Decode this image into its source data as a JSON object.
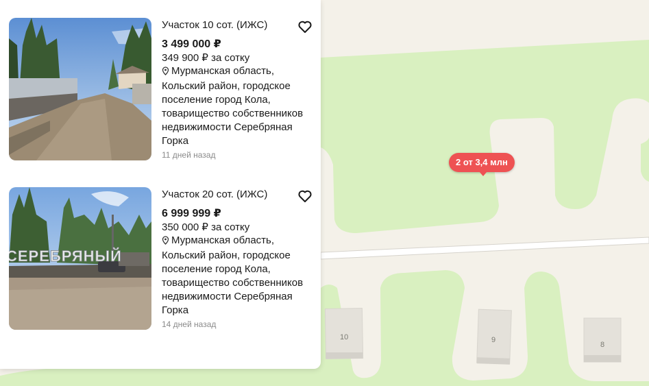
{
  "listings": [
    {
      "title": "Участок 10 сот. (ИЖС)",
      "price": "3 499 000 ₽",
      "price_per_sotka": "349 900 ₽ за сотку",
      "address": "Мурманская область, Кольский район, городское поселение город Кола, товарищество собственников недвижимости Серебряная Горка",
      "posted": "11 дней назад",
      "favorite_icon": "heart-outline-icon"
    },
    {
      "title": "Участок 20 сот. (ИЖС)",
      "price": "6 999 999 ₽",
      "price_per_sotka": "350 000 ₽ за сотку",
      "address": "Мурманская область, Кольский район, городское поселение город Кола, товарищество собственников недвижимости Серебряная Горка",
      "posted": "14 дней назад",
      "favorite_icon": "heart-outline-icon",
      "photo_sign_text": "СЕРЕБРЯНЫЙ"
    }
  ],
  "map": {
    "cluster_label": "2 от 3,4 млн",
    "house_numbers": [
      "10",
      "9",
      "8"
    ],
    "colors": {
      "greenery": "#d9f0c0",
      "land": "#f4f1e9",
      "building": "#e4e1da",
      "pin": "#ee5253"
    }
  }
}
